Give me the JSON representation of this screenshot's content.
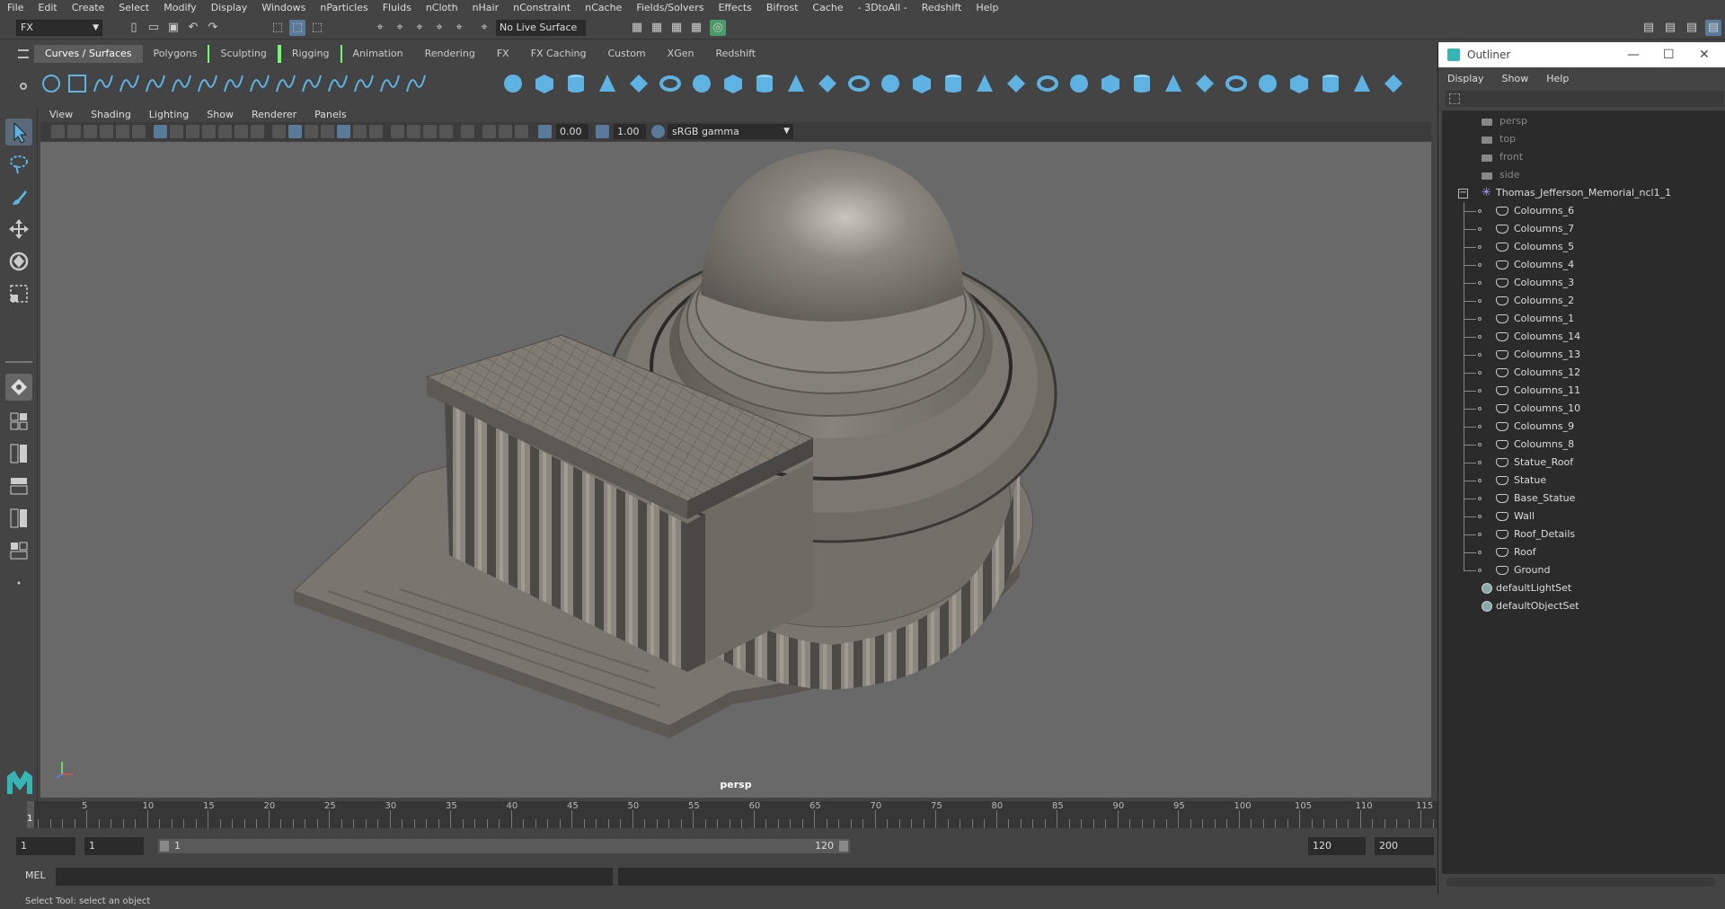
{
  "menubar": [
    "File",
    "Edit",
    "Create",
    "Select",
    "Modify",
    "Display",
    "Windows",
    "nParticles",
    "Fluids",
    "nCloth",
    "nHair",
    "nConstraint",
    "nCache",
    "Fields/Solvers",
    "Effects",
    "Bifrost",
    "Cache",
    "- 3DtoAll -",
    "Redshift",
    "Help"
  ],
  "statusline": {
    "mode": "FX",
    "live_surface": "No Live Surface"
  },
  "shelf_tabs": [
    "Curves / Surfaces",
    "Polygons",
    "Sculpting",
    "Rigging",
    "Animation",
    "Rendering",
    "FX",
    "FX Caching",
    "Custom",
    "XGen",
    "Redshift"
  ],
  "shelf_active": "Curves / Surfaces",
  "viewport": {
    "menu": [
      "View",
      "Shading",
      "Lighting",
      "Show",
      "Renderer",
      "Panels"
    ],
    "exposure": "0.00",
    "gamma_value": "1.00",
    "color_space": "sRGB gamma",
    "camera": "persp"
  },
  "timeline": {
    "ticks": [
      "5",
      "10",
      "15",
      "20",
      "25",
      "30",
      "35",
      "40",
      "45",
      "50",
      "55",
      "60",
      "65",
      "70",
      "75",
      "80",
      "85",
      "90",
      "95",
      "100",
      "105",
      "110",
      "115"
    ],
    "current_frame": "1"
  },
  "range": {
    "start": "1",
    "anim_start": "1",
    "slider_start": "1",
    "slider_end": "120",
    "end": "120",
    "anim_end": "200"
  },
  "cmdline": {
    "lang": "MEL"
  },
  "helpline": "Select Tool: select an object",
  "outliner": {
    "title": "Outliner",
    "menu": [
      "Display",
      "Show",
      "Help"
    ],
    "cameras": [
      "persp",
      "top",
      "front",
      "side"
    ],
    "root": "Thomas_Jefferson_Memorial_ncl1_1",
    "children": [
      "Coloumns_6",
      "Coloumns_7",
      "Coloumns_5",
      "Coloumns_4",
      "Coloumns_3",
      "Coloumns_2",
      "Coloumns_1",
      "Coloumns_14",
      "Coloumns_13",
      "Coloumns_12",
      "Coloumns_11",
      "Coloumns_10",
      "Coloumns_9",
      "Coloumns_8",
      "Statue_Roof",
      "Statue",
      "Base_Statue",
      "Wall",
      "Roof_Details",
      "Roof",
      "Ground"
    ],
    "sets": [
      "defaultLightSet",
      "defaultObjectSet"
    ]
  },
  "colors": {
    "accent": "#5a7a9a",
    "shelf_icon": "#5fb3e3",
    "viewport_bg": "#696969",
    "highlight": "#6dfc6d"
  }
}
